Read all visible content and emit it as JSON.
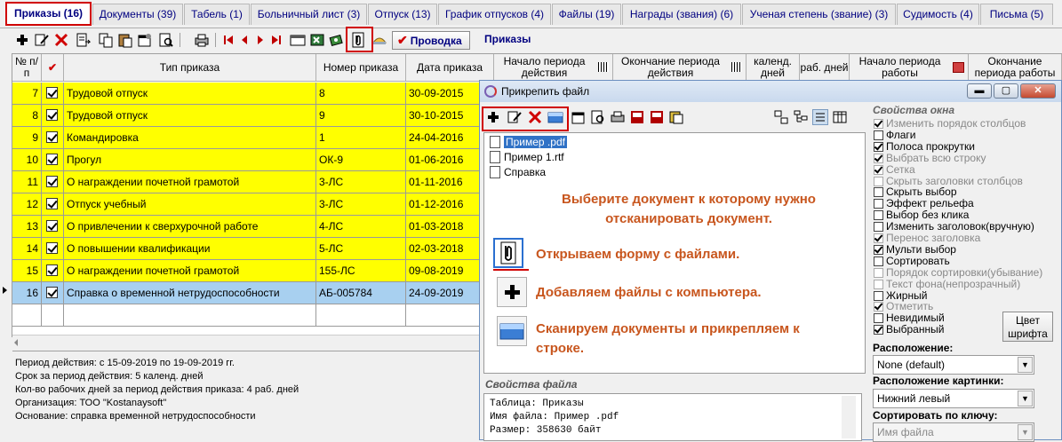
{
  "tabs": [
    {
      "label": "Приказы (16)",
      "active": true
    },
    {
      "label": "Документы (39)"
    },
    {
      "label": "Табель (1)"
    },
    {
      "label": "Больничный лист (3)"
    },
    {
      "label": "Отпуск (13)"
    },
    {
      "label": "График отпусков (4)"
    },
    {
      "label": "Файлы (19)"
    },
    {
      "label": "Награды (звания) (6)"
    },
    {
      "label": "Ученая степень (звание) (3)"
    },
    {
      "label": "Судимость (4)"
    },
    {
      "label": "Письма (5)"
    }
  ],
  "toolbar": {
    "post_label": "Проводка",
    "section_title": "Приказы",
    "icons": [
      "add-icon",
      "edit-icon",
      "delete-icon",
      "export-icon",
      "copy-icon",
      "paste-icon",
      "properties-icon",
      "preview-icon",
      "print-icon",
      "first-icon",
      "prev-icon",
      "next-icon",
      "last-icon",
      "card-icon",
      "excel-icon",
      "money-icon",
      "attach-icon",
      "folder-icon"
    ]
  },
  "grid": {
    "headers": [
      "№ п/п",
      "✔",
      "Тип приказа",
      "Номер приказа",
      "Дата приказа",
      "Начало периода действия",
      "Окончание периода действия",
      "календ. дней",
      "раб. дней",
      "Начало периода работы",
      "Окончание периода работы"
    ],
    "rows": [
      {
        "n": "7",
        "type": "Трудовой отпуск",
        "number": "8",
        "date": "30-09-2015"
      },
      {
        "n": "8",
        "type": "Трудовой отпуск",
        "number": "9",
        "date": "30-10-2015"
      },
      {
        "n": "9",
        "type": "Командировка",
        "number": "1",
        "date": "24-04-2016"
      },
      {
        "n": "10",
        "type": "Прогул",
        "number": "ОК-9",
        "date": "01-06-2016"
      },
      {
        "n": "11",
        "type": "О награждении почетной грамотой",
        "number": "3-ЛС",
        "date": "01-11-2016"
      },
      {
        "n": "12",
        "type": "Отпуск учебный",
        "number": "3-ЛС",
        "date": "01-12-2016"
      },
      {
        "n": "13",
        "type": "О привлечении к сверхурочной работе",
        "number": "4-ЛС",
        "date": "01-03-2018"
      },
      {
        "n": "14",
        "type": "О повышении квалификации",
        "number": "5-ЛС",
        "date": "02-03-2018"
      },
      {
        "n": "15",
        "type": "О награждении почетной грамотой",
        "number": "155-ЛС",
        "date": "09-08-2019"
      },
      {
        "n": "16",
        "type": "Справка о временной нетрудоспособности",
        "number": "АБ-005784",
        "date": "24-09-2019"
      }
    ]
  },
  "info": {
    "lines": [
      "Период действия: с 15-09-2019 по 19-09-2019 гг.",
      "Срок за период действия: 5 календ. дней",
      "Кол-во рабочих дней за период действия приказа: 4 раб. дней",
      "Организация: ТОО \"Kostanaysoft\"",
      "Основание: справка временной нетрудоспособности"
    ]
  },
  "dialog": {
    "title": "Прикрепить файл",
    "files": [
      "Пример .pdf",
      "Пример 1.rtf",
      "Справка"
    ],
    "notes": {
      "select": "Выберите документ к которому нужно отсканировать документ.",
      "open": "Открываем форму с файлами.",
      "add": "Добавляем файлы с компьютера.",
      "scan": "Сканируем документы и прикрепляем к строке."
    },
    "file_props_title": "Свойства файла",
    "file_props": [
      "Таблица: Приказы",
      "Имя файла: Пример .pdf",
      "Размер: 358630 байт"
    ],
    "window_props_title": "Свойства окна",
    "options": [
      {
        "label": "Изменить порядок столбцов",
        "checked": true,
        "disabled": true
      },
      {
        "label": "Флаги",
        "checked": false
      },
      {
        "label": "Полоса прокрутки",
        "checked": true
      },
      {
        "label": "Выбрать всю строку",
        "checked": true,
        "disabled": true
      },
      {
        "label": "Сетка",
        "checked": true,
        "disabled": true
      },
      {
        "label": "Скрыть заголовки столбцов",
        "checked": false,
        "disabled": true
      },
      {
        "label": "Скрыть выбор",
        "checked": false
      },
      {
        "label": "Эффект рельефа",
        "checked": false
      },
      {
        "label": "Выбор без клика",
        "checked": false
      },
      {
        "label": "Изменить заголовок(вручную)",
        "checked": false
      },
      {
        "label": "Перенос заголовка",
        "checked": true,
        "disabled": true
      },
      {
        "label": "Мульти выбор",
        "checked": true
      },
      {
        "label": "Сортировать",
        "checked": false
      },
      {
        "label": "Порядок сортировки(убывание)",
        "checked": false,
        "disabled": true
      },
      {
        "label": "Текст фона(непрозрачный)",
        "checked": false,
        "disabled": true
      },
      {
        "label": "Жирный",
        "checked": false
      },
      {
        "label": "Отметить",
        "checked": true,
        "disabled": true
      },
      {
        "label": "Невидимый",
        "checked": false
      },
      {
        "label": "Выбранный",
        "checked": true
      }
    ],
    "color_button": "Цвет шрифта",
    "location_label": "Расположение:",
    "location_value": "None (default)",
    "image_location_label": "Расположение картинки:",
    "image_location_value": "Нижний левый",
    "sort_key_label": "Сортировать по ключу:",
    "sort_key_value": "Имя файла"
  }
}
